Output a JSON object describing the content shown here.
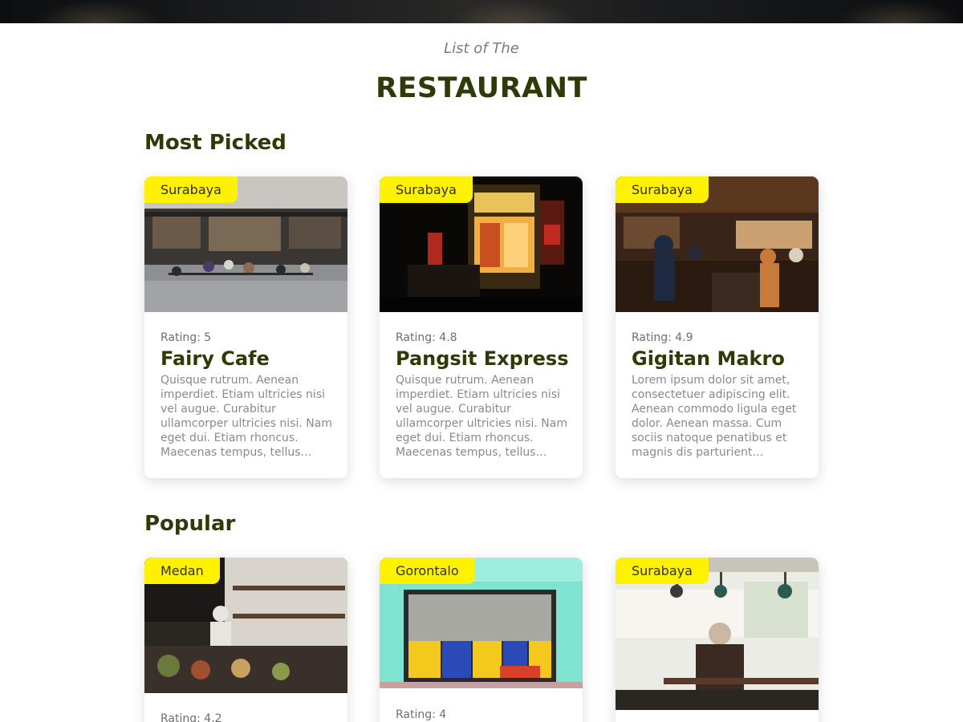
{
  "header": {
    "subtitle": "List of The",
    "title": "RESTAURANT"
  },
  "sections": [
    {
      "title": "Most Picked",
      "cards": [
        {
          "city": "Surabaya",
          "rating": "Rating: 5",
          "name": "Fairy Cafe",
          "description": "Quisque rutrum. Aenean imperdiet. Etiam ultricies nisi vel augue. Curabitur ullamcorper ultricies nisi. Nam eget dui. Etiam rhoncus. Maecenas tempus, tellus ege…"
        },
        {
          "city": "Surabaya",
          "rating": "Rating: 4.8",
          "name": "Pangsit Express",
          "description": "Quisque rutrum. Aenean imperdiet. Etiam ultricies nisi vel augue. Curabitur ullamcorper ultricies nisi. Nam eget dui. Etiam rhoncus. Maecenas tempus, tellus ege…"
        },
        {
          "city": "Surabaya",
          "rating": "Rating: 4.9",
          "name": "Gigitan Makro",
          "description": "Lorem ipsum dolor sit amet, consectetuer adipiscing elit. Aenean commodo ligula eget dolor. Aenean massa. Cum sociis natoque penatibus et magnis dis parturient montes…"
        }
      ]
    },
    {
      "title": "Popular",
      "cards": [
        {
          "city": "Medan",
          "rating": "Rating: 4.2"
        },
        {
          "city": "Gorontalo",
          "rating": "Rating: 4"
        },
        {
          "city": "Surabaya"
        }
      ]
    }
  ],
  "colors": {
    "heading": "#2e3a07",
    "badge": "#fff200",
    "muted_text": "#8a8a8a"
  }
}
